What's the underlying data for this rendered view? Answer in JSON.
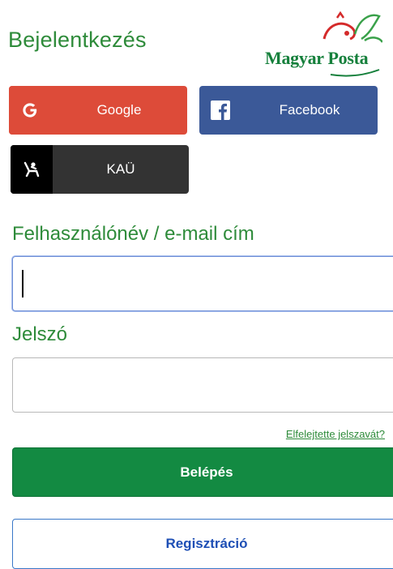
{
  "page": {
    "title": "Bejelentkezés"
  },
  "logo": {
    "text": "Magyar Posta",
    "icon": "posthorn-logo-icon"
  },
  "social": {
    "google": {
      "label": "Google",
      "icon": "google-icon",
      "color": "#dd4b39"
    },
    "facebook": {
      "label": "Facebook",
      "icon": "facebook-icon",
      "color": "#3b5998"
    },
    "kau": {
      "label": "KAÜ",
      "icon": "kau-icon",
      "color": "#333333"
    }
  },
  "form": {
    "username_label": "Felhasználónév / e-mail cím",
    "username_value": "",
    "password_label": "Jelszó",
    "password_value": "",
    "forgot_link": "Elfelejtette jelszavát?",
    "login_button": "Belépés",
    "register_button": "Regisztráció"
  },
  "colors": {
    "brand_green": "#138a42",
    "label_green": "#2e8b3a",
    "link_blue": "#1e4fb5"
  }
}
